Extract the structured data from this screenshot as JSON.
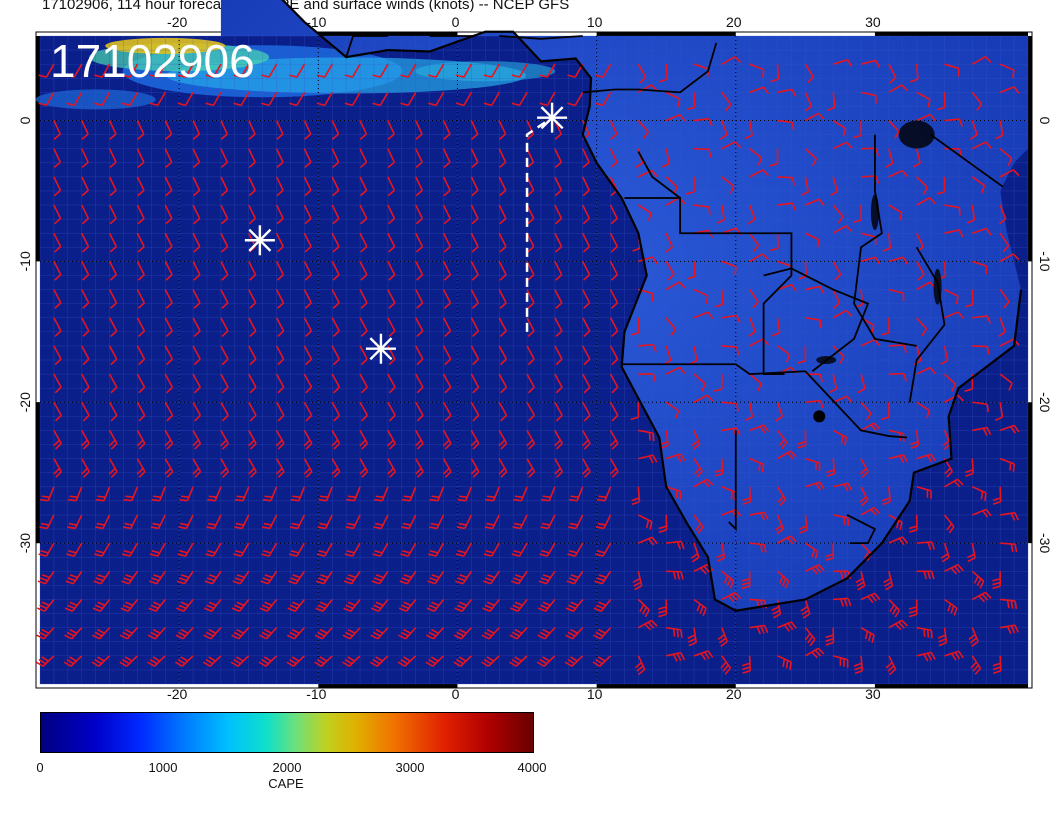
{
  "title": "17102906, 114 hour forecast for CAPE and surface winds (knots) -- NCEP GFS",
  "stamp": "17102906",
  "axes": {
    "x_ticks": [
      "-20",
      "-10",
      "0",
      "10",
      "20",
      "30"
    ],
    "y_ticks": [
      "0",
      "-10",
      "-20",
      "-30"
    ],
    "x_range": [
      -30,
      41
    ],
    "y_range": [
      -40,
      6
    ]
  },
  "colorbar": {
    "label": "CAPE",
    "tick_labels": [
      "0",
      "1000",
      "2000",
      "3000",
      "4000"
    ],
    "range": [
      0,
      4000
    ]
  },
  "colors": {
    "ocean": "#0b1f8a",
    "land": "#1432b0",
    "wind_barbs": "#e8141e",
    "coastline": "#000000",
    "markers": "#ffffff",
    "frame_band": "#000000"
  },
  "markers": [
    {
      "name": "star-marker-1",
      "lon": 6.8,
      "lat": 0.2
    },
    {
      "name": "star-marker-2",
      "lon": -14.2,
      "lat": -8.5
    },
    {
      "name": "star-marker-3",
      "lon": -5.5,
      "lat": -16.2
    }
  ],
  "dashed_track": {
    "points": [
      [
        5.0,
        -15.0
      ],
      [
        5.0,
        -1.0
      ],
      [
        6.8,
        0.2
      ]
    ]
  },
  "map_features": {
    "wind_barbs": "red wind barbs on regular lat/lon grid",
    "coastlines": "Africa and Gulf of Guinea coastlines with country borders"
  }
}
